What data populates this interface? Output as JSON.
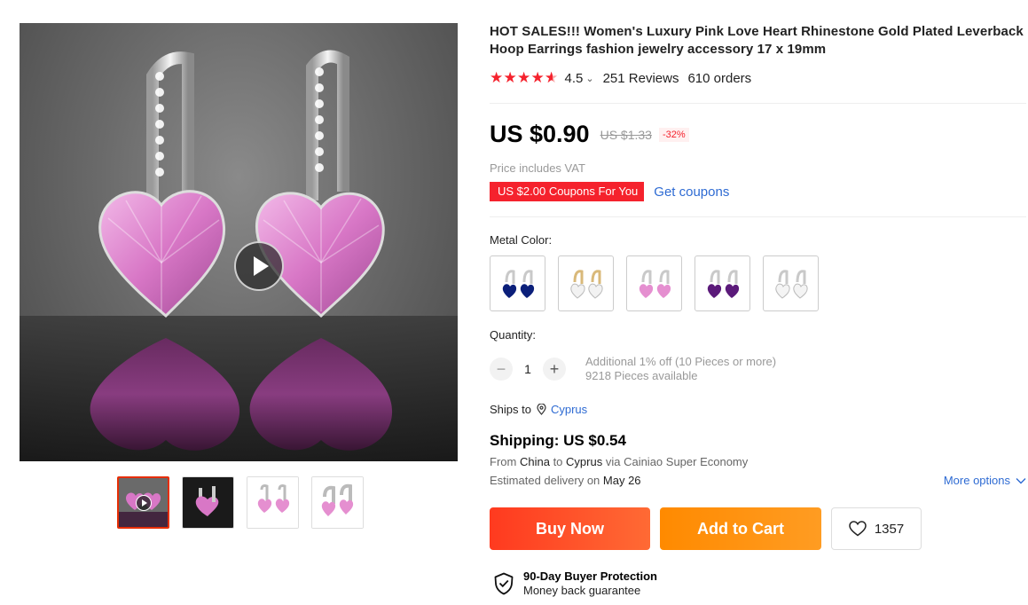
{
  "gallery": {
    "thumbnail_count": 4,
    "active_thumbnail": 1,
    "has_video": true
  },
  "product": {
    "title": "HOT SALES!!! Women's Luxury Pink Love Heart Rhinestone Gold Plated Leverback Hoop Earrings fashion jewelry accessory 17 x 19mm",
    "rating": "4.5",
    "stars": 4.5,
    "reviews": "251 Reviews",
    "orders": "610 orders"
  },
  "price": {
    "current": "US $0.90",
    "original": "US $1.33",
    "discount": "-32%",
    "vat_note": "Price includes VAT",
    "coupon": "US $2.00 Coupons For You",
    "get_coupons": "Get coupons"
  },
  "sku": {
    "color_label": "Metal Color:",
    "options": [
      {
        "name": "blue",
        "gem_color": "#0b1f7a",
        "metal": "#c9c9c9"
      },
      {
        "name": "white-gold",
        "gem_color": "#f2f2f2",
        "metal": "#d9b97a"
      },
      {
        "name": "pink",
        "gem_color": "#e58fd0",
        "metal": "#c9c9c9"
      },
      {
        "name": "purple",
        "gem_color": "#5b1a7a",
        "metal": "#c9c9c9"
      },
      {
        "name": "white",
        "gem_color": "#f4f4f4",
        "metal": "#c9c9c9"
      }
    ]
  },
  "quantity": {
    "label": "Quantity:",
    "minus": "−",
    "plus": "+",
    "value": "1",
    "discount_note": "Additional 1% off (10 Pieces or more)",
    "available": "9218 Pieces available"
  },
  "shipping": {
    "ships_to_label": "Ships to",
    "country": "Cyprus",
    "title": "Shipping: US $0.54",
    "from_prefix": "From",
    "from": "China",
    "to_prefix": "to",
    "to": "Cyprus",
    "via": "via Cainiao Super Economy",
    "delivery_prefix": "Estimated delivery on",
    "delivery_date": "May 26",
    "more_options": "More options"
  },
  "actions": {
    "buy_now": "Buy Now",
    "add_to_cart": "Add to Cart",
    "wishlist_count": "1357"
  },
  "protection": {
    "title": "90-Day Buyer Protection",
    "subtitle": "Money back guarantee"
  },
  "colors": {
    "accent_red": "#f5222d",
    "link_blue": "#2e6bd3",
    "buy_orange_red": "#ff4b26",
    "cart_orange": "#ff9200"
  }
}
